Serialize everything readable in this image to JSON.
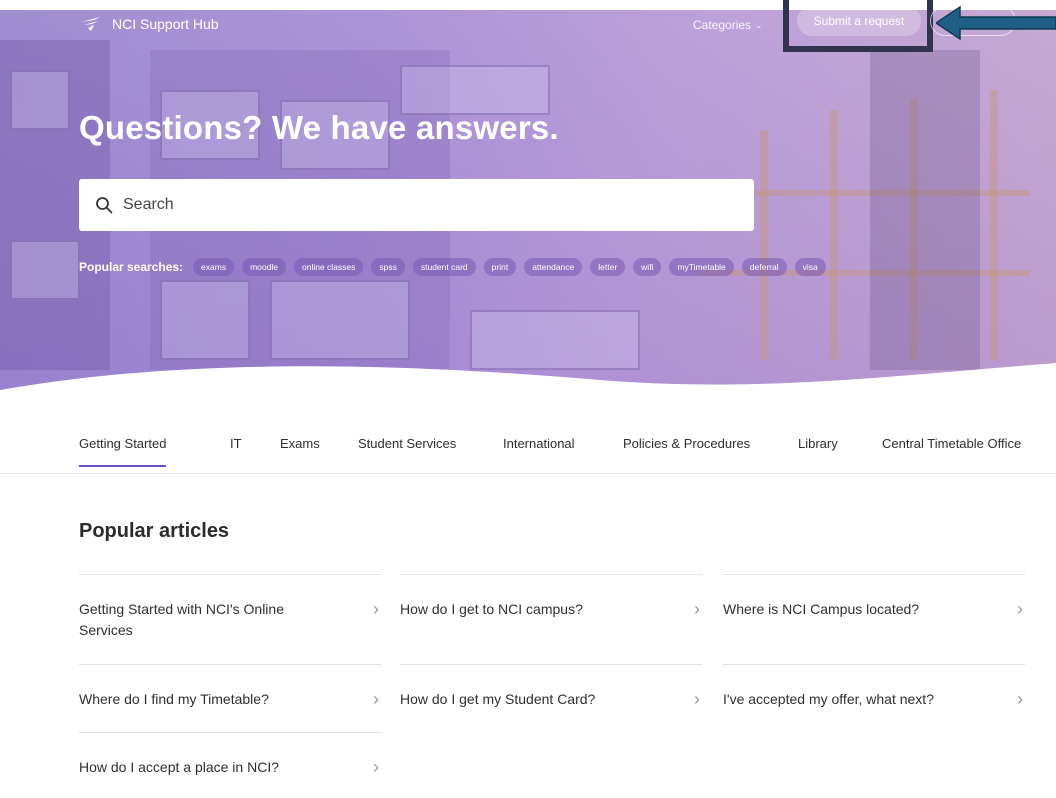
{
  "header": {
    "brand": "NCI Support Hub",
    "nav_categories": "Categories",
    "submit_request": "Submit a request"
  },
  "hero": {
    "title": "Questions? We have answers.",
    "search_placeholder": "Search",
    "popular_label": "Popular searches:",
    "popular_searches": [
      "exams",
      "moodle",
      "online classes",
      "spss",
      "student card",
      "print",
      "attendance",
      "letter",
      "wifi",
      "myTimetable",
      "deferral",
      "visa"
    ]
  },
  "tabs": [
    {
      "label": "Getting Started",
      "active": true
    },
    {
      "label": "IT",
      "active": false
    },
    {
      "label": "Exams",
      "active": false
    },
    {
      "label": "Student Services",
      "active": false
    },
    {
      "label": "International",
      "active": false
    },
    {
      "label": "Policies & Procedures",
      "active": false
    },
    {
      "label": "Library",
      "active": false
    },
    {
      "label": "Central Timetable Office",
      "active": false
    }
  ],
  "popular_articles": {
    "title": "Popular articles",
    "items": [
      "Getting Started with NCI's Online Services",
      "How do I get to NCI campus?",
      "Where is NCI Campus located?",
      "Where do I find my Timetable?",
      "How do I get my Student Card?",
      "I've accepted my offer, what next?",
      "How do I accept a place in NCI?"
    ]
  },
  "colors": {
    "accent": "#6d4ec1",
    "annotation_box": "#31344f",
    "annotation_arrow": "#1f5f86"
  },
  "icons": {
    "brand_logo": "nci-logo-icon",
    "search": "search-icon",
    "chevron": "chevron-right-icon"
  }
}
